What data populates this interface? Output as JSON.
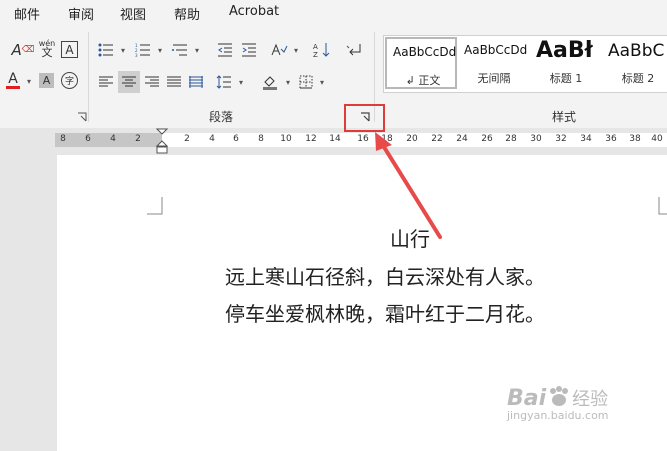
{
  "tabs": [
    "邮件",
    "审阅",
    "视图",
    "帮助",
    "Acrobat"
  ],
  "ribbon": {
    "paragraph_label": "段落",
    "styles_label": "样式",
    "phonetic_top": "wén",
    "phonetic_bottom": "文",
    "font_box_char": "A",
    "font_color_char": "A",
    "highlight_char": "A",
    "enclose_char": "字",
    "font_color_hex": "#e02020"
  },
  "styles": [
    {
      "sample": "AaBbCcDd",
      "name": "正文"
    },
    {
      "sample": "AaBbCcDd",
      "name": "无间隔"
    },
    {
      "sample": "AaBł",
      "name": "标题 1"
    },
    {
      "sample": "AaBbC",
      "name": "标题 2"
    }
  ],
  "ruler": {
    "left_ticks": [
      "8",
      "6",
      "4",
      "2"
    ],
    "right_ticks": [
      "2",
      "4",
      "6",
      "8",
      "10",
      "12",
      "14",
      "16",
      "18",
      "20",
      "22",
      "24",
      "26",
      "28",
      "30",
      "32",
      "34",
      "36",
      "38",
      "40"
    ]
  },
  "document": {
    "title": "山行",
    "line1": "远上寒山石径斜，白云深处有人家。",
    "line2": "停车坐爱枫林晚，霜叶红于二月花。"
  },
  "watermark": {
    "brand": "Bai",
    "sub": "经验",
    "url": "jingyan.baidu.com"
  }
}
